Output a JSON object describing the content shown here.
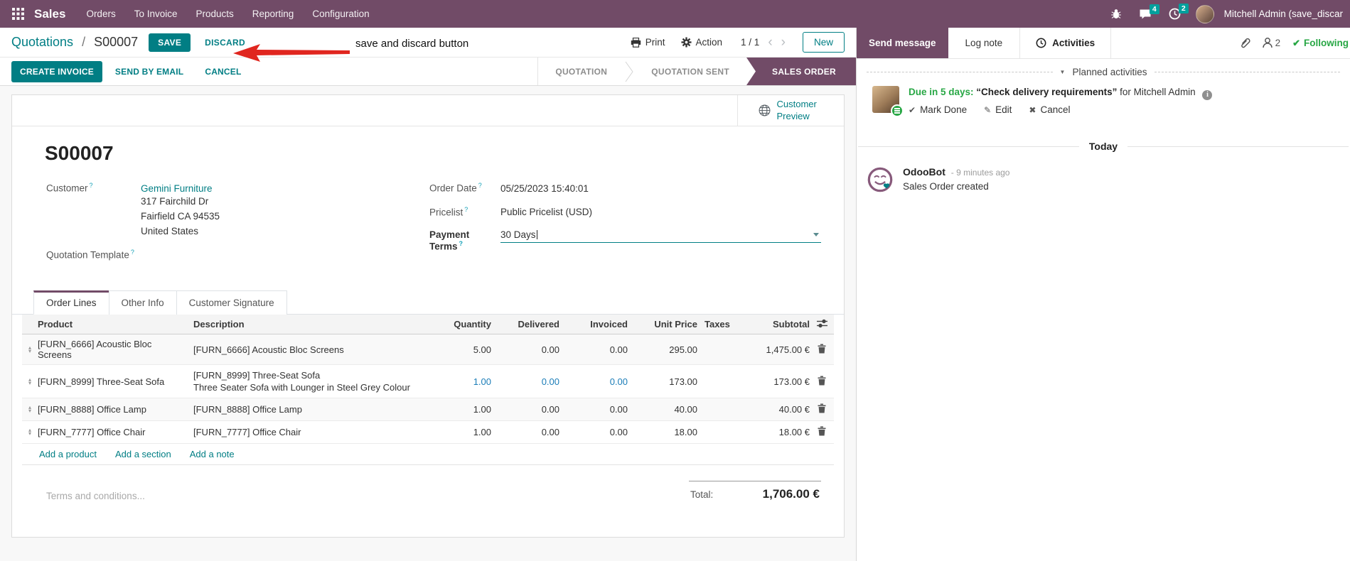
{
  "navbar": {
    "app_name": "Sales",
    "menu_items": [
      "Orders",
      "To Invoice",
      "Products",
      "Reporting",
      "Configuration"
    ],
    "messages_badge": "4",
    "activities_badge": "2",
    "user_name": "Mitchell Admin (save_discar"
  },
  "control_panel": {
    "breadcrumb_parent": "Quotations",
    "breadcrumb_separator": "/",
    "breadcrumb_current": "S00007",
    "save_label": "SAVE",
    "discard_label": "DISCARD",
    "print_label": "Print",
    "action_label": "Action",
    "pager": "1 / 1",
    "prev_label": "‹",
    "next_label": "›",
    "new_label": "New"
  },
  "annotation": {
    "text": "save and discard button"
  },
  "action_row": {
    "create_invoice_label": "CREATE INVOICE",
    "send_by_email_label": "SEND BY EMAIL",
    "cancel_label": "CANCEL",
    "statusbar": [
      {
        "label": "QUOTATION",
        "active": false
      },
      {
        "label": "QUOTATION SENT",
        "active": false
      },
      {
        "label": "SALES ORDER",
        "active": true
      }
    ]
  },
  "form": {
    "help_marker": "?",
    "customer_preview_label": "Customer Preview",
    "title": "S00007",
    "customer_label": "Customer",
    "customer_name": "Gemini Furniture",
    "customer_address_line1": "317 Fairchild Dr",
    "customer_address_line2": "Fairfield CA 94535",
    "customer_address_line3": "United States",
    "quotation_template_label": "Quotation Template",
    "order_date_label": "Order Date",
    "order_date_value": "05/25/2023 15:40:01",
    "pricelist_label": "Pricelist",
    "pricelist_value": "Public Pricelist (USD)",
    "payment_terms_label": "Payment Terms",
    "payment_terms_value": "30 Days",
    "tabs": [
      "Order Lines",
      "Other Info",
      "Customer Signature"
    ],
    "table": {
      "columns": [
        "Product",
        "Description",
        "Quantity",
        "Delivered",
        "Invoiced",
        "Unit Price",
        "Taxes",
        "Subtotal"
      ],
      "rows": [
        {
          "product": "[FURN_6666] Acoustic Bloc Screens",
          "description": "[FURN_6666] Acoustic Bloc Screens",
          "description2": "",
          "quantity": "5.00",
          "delivered": "0.00",
          "invoiced": "0.00",
          "unit_price": "295.00",
          "taxes": "",
          "subtotal": "1,475.00 €"
        },
        {
          "product": "[FURN_8999] Three-Seat Sofa",
          "description": "[FURN_8999] Three-Seat Sofa",
          "description2": "Three Seater Sofa with Lounger in Steel Grey Colour",
          "quantity": "1.00",
          "delivered": "0.00",
          "invoiced": "0.00",
          "unit_price": "173.00",
          "taxes": "",
          "subtotal": "173.00 €"
        },
        {
          "product": "[FURN_8888] Office Lamp",
          "description": "[FURN_8888] Office Lamp",
          "description2": "",
          "quantity": "1.00",
          "delivered": "0.00",
          "invoiced": "0.00",
          "unit_price": "40.00",
          "taxes": "",
          "subtotal": "40.00 €"
        },
        {
          "product": "[FURN_7777] Office Chair",
          "description": "[FURN_7777] Office Chair",
          "description2": "",
          "quantity": "1.00",
          "delivered": "0.00",
          "invoiced": "0.00",
          "unit_price": "18.00",
          "taxes": "",
          "subtotal": "18.00 €"
        }
      ],
      "add_product_label": "Add a product",
      "add_section_label": "Add a section",
      "add_note_label": "Add a note"
    },
    "terms_placeholder": "Terms and conditions...",
    "total_label": "Total:",
    "total_value": "1,706.00 €"
  },
  "chatter": {
    "send_message_label": "Send message",
    "log_note_label": "Log note",
    "activities_label": "Activities",
    "follower_count": "2",
    "following_label": "Following",
    "planned_header": "Planned activities",
    "activity": {
      "due": "Due in 5 days:",
      "summary": "“Check delivery requirements”",
      "assignee": "for Mitchell Admin",
      "mark_done_label": "Mark Done",
      "edit_label": "Edit",
      "cancel_label": "Cancel"
    },
    "today_label": "Today",
    "message": {
      "author": "OdooBot",
      "timestamp": "- 9 minutes ago",
      "body": "Sales Order created"
    }
  },
  "colors": {
    "brand_purple": "#714B67",
    "accent_teal": "#017E84",
    "badge_teal": "#00A09D",
    "highlight_blue": "#1B7DB8",
    "success_green": "#28A745",
    "annotation_red": "#E0261F"
  }
}
